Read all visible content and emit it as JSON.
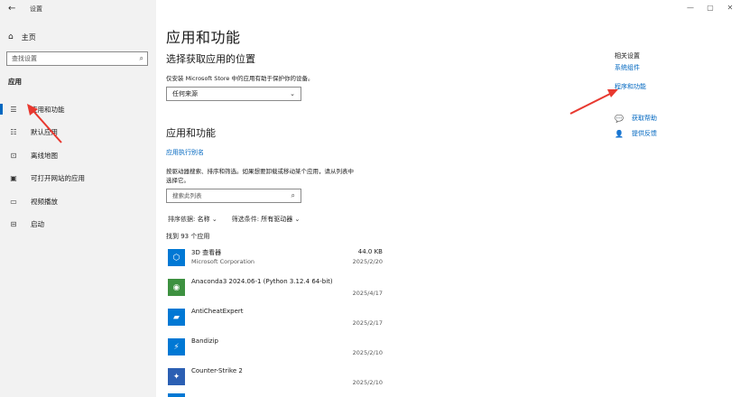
{
  "window": {
    "title": "设置",
    "back_glyph": "←",
    "controls": {
      "minimize": "—",
      "maximize": "▢",
      "close": "✕"
    }
  },
  "sidebar": {
    "home_label": "主页",
    "search_placeholder": "查找设置",
    "section_label": "应用",
    "items": [
      {
        "label": "应用和功能",
        "icon": "apps-list-icon",
        "glyph": "☰",
        "active": true
      },
      {
        "label": "默认应用",
        "icon": "default-apps-icon",
        "glyph": "☷",
        "active": false
      },
      {
        "label": "离线地图",
        "icon": "map-icon",
        "glyph": "⊡",
        "active": false
      },
      {
        "label": "可打开网站的应用",
        "icon": "website-apps-icon",
        "glyph": "▣",
        "active": false
      },
      {
        "label": "视频播放",
        "icon": "video-icon",
        "glyph": "▭",
        "active": false
      },
      {
        "label": "启动",
        "icon": "startup-icon",
        "glyph": "⊟",
        "active": false
      }
    ]
  },
  "main": {
    "title": "应用和功能",
    "install_source": {
      "heading": "选择获取应用的位置",
      "description": "仅安装 Microsoft Store 中的应用有助于保护你的设备。",
      "dropdown_value": "任何来源"
    },
    "apps": {
      "heading": "应用和功能",
      "alias_link": "应用执行别名",
      "description_line1": "按驱动器搜索、排序和筛选。如果想要卸载或移动某个应用，请从列表中",
      "description_line2": "选择它。",
      "search_placeholder": "搜索此列表",
      "sort_label": "排序依据:",
      "sort_value": "名称",
      "filter_label": "筛选条件:",
      "filter_value": "所有驱动器",
      "found_text": "找到 93 个应用",
      "list": [
        {
          "name": "3D 查看器",
          "publisher": "Microsoft Corporation",
          "size": "44.0 KB",
          "date": "2025/2/20",
          "icon_color": "#0078d4",
          "icon_glyph": "⬡"
        },
        {
          "name": "Anaconda3 2024.06-1 (Python 3.12.4 64-bit)",
          "publisher": "",
          "size": "",
          "date": "2025/4/17",
          "icon_color": "#3d9140",
          "icon_glyph": "◉"
        },
        {
          "name": "AntiCheatExpert",
          "publisher": "",
          "size": "",
          "date": "2025/2/17",
          "icon_color": "#0078d4",
          "icon_glyph": "▰"
        },
        {
          "name": "Bandizip",
          "publisher": "",
          "size": "",
          "date": "2025/2/10",
          "icon_color": "#0078d4",
          "icon_glyph": "⚡"
        },
        {
          "name": "Counter-Strike 2",
          "publisher": "",
          "size": "",
          "date": "2025/2/10",
          "icon_color": "#2b5fb3",
          "icon_glyph": "✦"
        }
      ]
    }
  },
  "related": {
    "title": "相关设置",
    "links": [
      "系统组件",
      "程序和功能"
    ],
    "help": [
      {
        "label": "获取帮助",
        "icon": "help-chat-icon",
        "glyph": "❓"
      },
      {
        "label": "提供反馈",
        "icon": "feedback-icon",
        "glyph": "✎"
      }
    ]
  },
  "annotation_color": "#e8382f"
}
